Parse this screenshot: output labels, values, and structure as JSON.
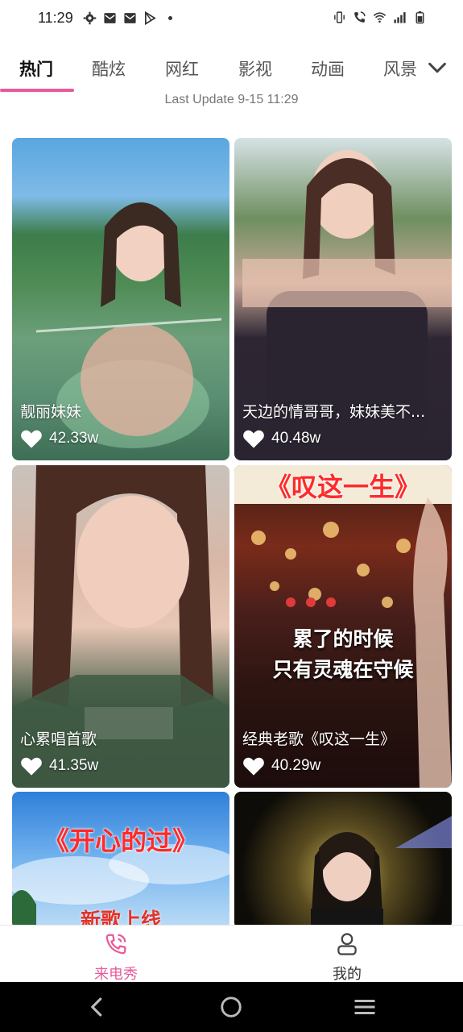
{
  "status": {
    "time": "11:29",
    "left_icons": [
      "gear-icon",
      "mail-icon",
      "mail-icon",
      "play-store-icon",
      "dot-icon"
    ],
    "right_icons": [
      "vibrate-icon",
      "wifi-call-icon",
      "wifi-icon",
      "signal-icon",
      "battery-icon"
    ]
  },
  "tabs": {
    "items": [
      "热门",
      "酷炫",
      "网红",
      "影视",
      "动画",
      "风景"
    ],
    "active": "热门",
    "accent": "#e85a9b"
  },
  "last_update": "Last Update 9-15 11:29",
  "cards": [
    {
      "title": "靓丽妹妹",
      "likes": "42.33w"
    },
    {
      "title": "天边的情哥哥，妹妹美不...",
      "likes": "40.48w"
    },
    {
      "title": "心累唱首歌",
      "likes": "41.35w"
    },
    {
      "title": "经典老歌《叹这一生》",
      "likes": "40.29w",
      "poster_title": "《叹这一生》",
      "poster_line1": "累了的时候",
      "poster_line2": "只有灵魂在守候"
    },
    {
      "poster_title": "《开心的过》",
      "poster_line1": "新歌上线"
    },
    {}
  ],
  "bottom_nav": {
    "items": [
      {
        "label": "来电秀",
        "icon": "phone-icon"
      },
      {
        "label": "我的",
        "icon": "user-icon"
      }
    ]
  },
  "system_nav": [
    "back-icon",
    "home-icon",
    "recents-icon"
  ]
}
